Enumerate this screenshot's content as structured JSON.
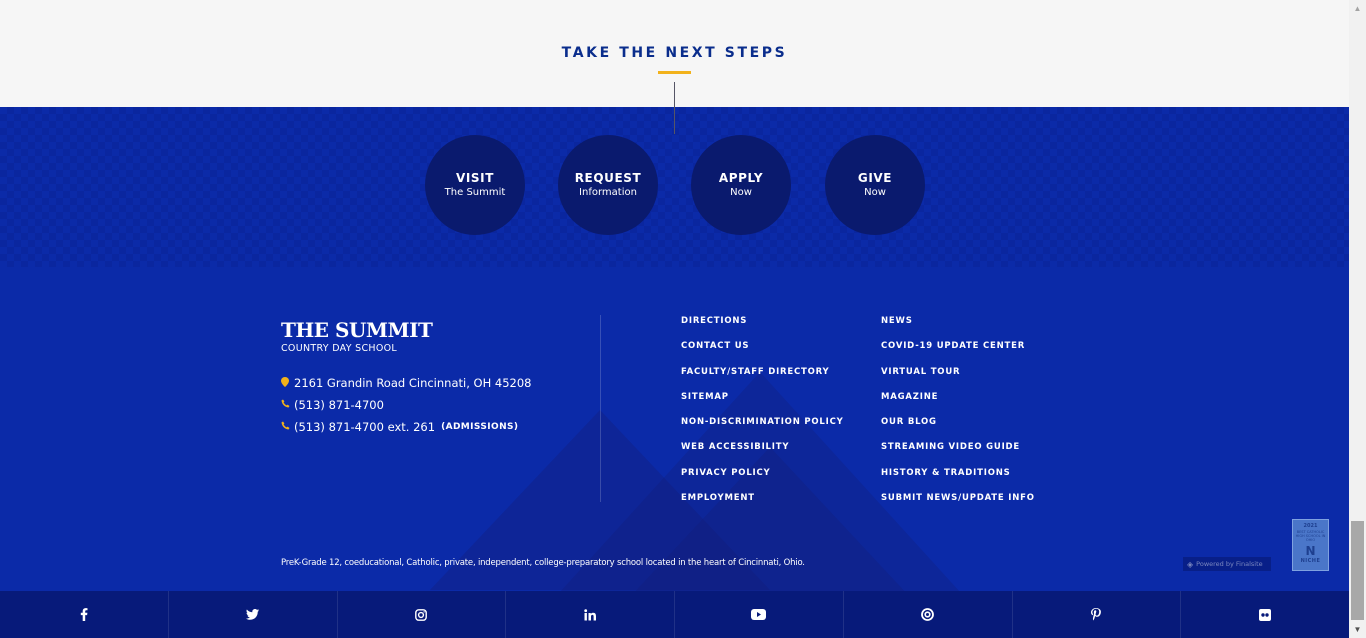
{
  "next_steps": {
    "title": "TAKE THE NEXT STEPS",
    "buttons": [
      {
        "title": "VISIT",
        "sub": "The Summit"
      },
      {
        "title": "REQUEST",
        "sub": "Information"
      },
      {
        "title": "APPLY",
        "sub": "Now"
      },
      {
        "title": "GIVE",
        "sub": "Now"
      }
    ]
  },
  "footer": {
    "logo_main": "THE SUMMIT",
    "logo_sub": "COUNTRY DAY SCHOOL",
    "address": "2161 Grandin Road Cincinnati, OH 45208",
    "phone": "(513) 871-4700",
    "admissions_phone": "(513) 871-4700 ext. 261",
    "admissions_label": "(ADMISSIONS)",
    "links_col1": [
      "DIRECTIONS",
      "CONTACT US",
      "FACULTY/STAFF DIRECTORY",
      "SITEMAP",
      "NON-DISCRIMINATION POLICY",
      "WEB ACCESSIBILITY",
      "PRIVACY POLICY",
      "EMPLOYMENT"
    ],
    "links_col2": [
      "NEWS",
      "COVID-19 UPDATE CENTER",
      "VIRTUAL TOUR",
      "MAGAZINE",
      "OUR BLOG",
      "STREAMING VIDEO GUIDE",
      "HISTORY & TRADITIONS",
      "SUBMIT NEWS/UPDATE INFO"
    ],
    "tagline": "PreK-Grade 12, coeducational, Catholic, private, independent, college-preparatory school located in the heart of Cincinnati, Ohio.",
    "powered_by": "Powered by Finalsite",
    "niche_badge": {
      "year": "2021",
      "desc": "BEST CATHOLIC HIGH SCHOOL IN OHIO",
      "mark": "N",
      "name": "NICHE"
    }
  },
  "social": [
    "facebook-icon",
    "twitter-icon",
    "instagram-icon",
    "linkedin-icon",
    "youtube-icon",
    "podcast-icon",
    "pinterest-icon",
    "flickr-icon"
  ],
  "colors": {
    "brand_blue": "#0b2aa8",
    "dark_blue": "#0a1a6e",
    "social_bar": "#071a7a",
    "gold": "#f2b21b",
    "title_blue": "#0a2d8c"
  }
}
